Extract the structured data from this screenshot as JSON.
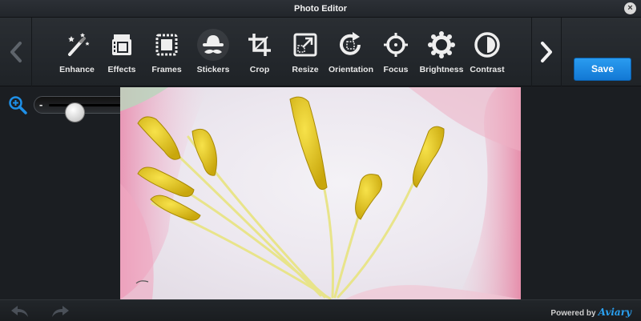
{
  "window": {
    "title": "Photo Editor",
    "close_label": "×"
  },
  "toolbar": {
    "tools": [
      {
        "label": "Enhance",
        "icon": "magic-wand-icon"
      },
      {
        "label": "Effects",
        "icon": "film-strip-icon"
      },
      {
        "label": "Frames",
        "icon": "frame-icon"
      },
      {
        "label": "Stickers",
        "icon": "hat-mustache-icon",
        "active": true
      },
      {
        "label": "Crop",
        "icon": "crop-icon"
      },
      {
        "label": "Resize",
        "icon": "resize-icon"
      },
      {
        "label": "Orientation",
        "icon": "rotate-icon"
      },
      {
        "label": "Focus",
        "icon": "focus-icon"
      },
      {
        "label": "Brightness",
        "icon": "sun-icon"
      },
      {
        "label": "Contrast",
        "icon": "contrast-icon"
      }
    ],
    "save_label": "Save"
  },
  "zoom": {
    "minus": "-",
    "plus": "+",
    "value_fraction": 0.22
  },
  "footer": {
    "powered_by": "Powered by",
    "brand": "Aviary"
  },
  "colors": {
    "accent": "#1a86e0",
    "background": "#1b1e22",
    "toolbar": "#262a2f"
  }
}
